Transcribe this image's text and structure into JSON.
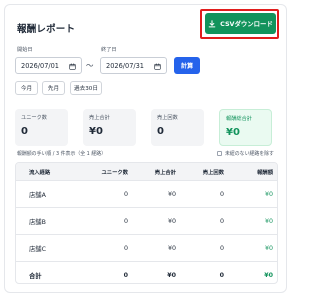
{
  "page": {
    "title": "報酬レポート"
  },
  "toolbar": {
    "csv_label": "CSVダウンロード"
  },
  "filters": {
    "start_label": "開始日",
    "end_label": "終了日",
    "start_value": "2026/07/01",
    "end_value": "2026/07/31",
    "separator": "〜",
    "calc_label": "計算",
    "presets": [
      "今月",
      "先月",
      "過去30日"
    ]
  },
  "summary": [
    {
      "label": "ユニーク数",
      "value": "0"
    },
    {
      "label": "売上合計",
      "value": "¥0"
    },
    {
      "label": "売上回数",
      "value": "0"
    },
    {
      "label": "報酬総合計",
      "value": "¥0"
    }
  ],
  "table": {
    "title": "報酬額の手い順 / 3 件表示（全 1 経路）",
    "checkbox_label": "未紐のない経路を除す",
    "headers": [
      "流入経路",
      "ユニーク数",
      "売上合計",
      "売上回数",
      "報酬額"
    ],
    "rows": [
      [
        "店舗A",
        "0",
        "¥0",
        "0",
        "¥0"
      ],
      [
        "店舗B",
        "0",
        "¥0",
        "0",
        "¥0"
      ],
      [
        "店舗C",
        "0",
        "¥0",
        "0",
        "¥0"
      ],
      [
        "合計",
        "0",
        "¥0",
        "0",
        "¥0"
      ]
    ]
  },
  "colors": {
    "accent_green": "#12935c",
    "primary_blue": "#2563eb",
    "highlight_red": "#e11d1d"
  },
  "icons": {
    "download": "download-icon",
    "calendar": "calendar-icon"
  }
}
